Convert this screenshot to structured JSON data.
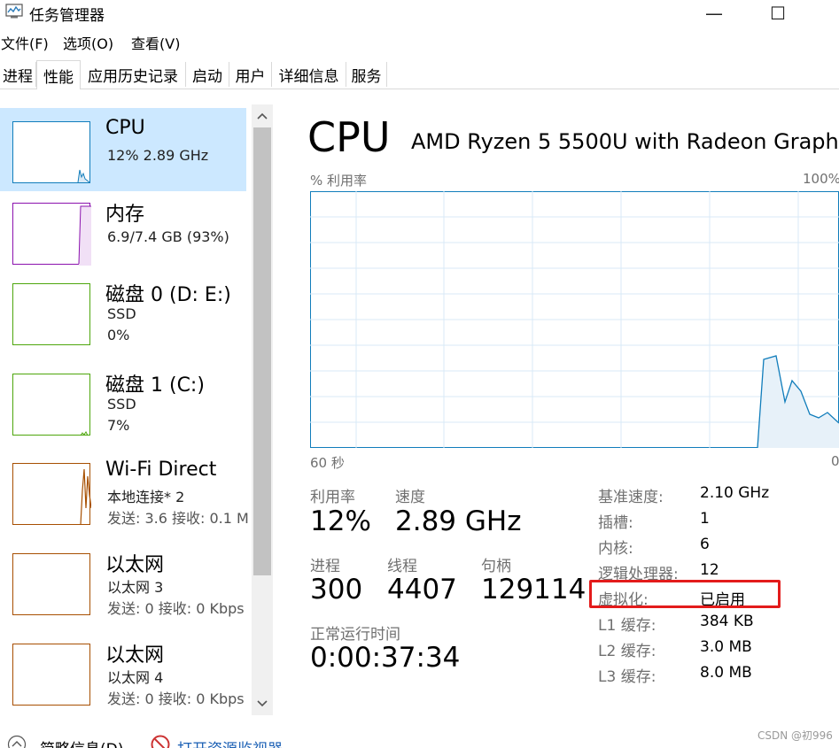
{
  "window": {
    "title": "任务管理器",
    "minimize_glyph": "—",
    "maximize_glyph": "☐"
  },
  "menu": [
    "文件(F)",
    "选项(O)",
    "查看(V)"
  ],
  "tabs": [
    "进程",
    "性能",
    "应用历史记录",
    "启动",
    "用户",
    "详细信息",
    "服务"
  ],
  "active_tab": "性能",
  "resources": [
    {
      "name": "CPU",
      "lines": [
        "12%  2.89 GHz"
      ],
      "color": "#117dbb"
    },
    {
      "name": "内存",
      "lines": [
        "6.9/7.4 GB (93%)"
      ],
      "color": "#8b12ae"
    },
    {
      "name": "磁盘 0 (D: E:)",
      "lines": [
        "SSD",
        "0%"
      ],
      "color": "#4da60c"
    },
    {
      "name": "磁盘 1 (C:)",
      "lines": [
        "SSD",
        "7%"
      ],
      "color": "#4da60c"
    },
    {
      "name": "Wi-Fi Direct",
      "lines": [
        "本地连接* 2",
        "发送: 3.6  接收: 0.1 M"
      ],
      "color": "#a74f01"
    },
    {
      "name": "以太网",
      "lines": [
        "以太网 3",
        "发送: 0  接收: 0 Kbps"
      ],
      "color": "#a74f01"
    },
    {
      "name": "以太网",
      "lines": [
        "以太网 4",
        "发送: 0  接收: 0 Kbps"
      ],
      "color": "#a74f01"
    }
  ],
  "cpu": {
    "heading": "CPU",
    "model": "AMD Ryzen 5 5500U with Radeon Graph...",
    "util_label": "% 利用率",
    "util_max": "100%",
    "x_left": "60 秒",
    "x_right": "0",
    "graph_color": "#117dbb",
    "stats": {
      "utilization_label": "利用率",
      "utilization": "12%",
      "speed_label": "速度",
      "speed": "2.89 GHz",
      "processes_label": "进程",
      "processes": "300",
      "threads_label": "线程",
      "threads": "4407",
      "handles_label": "句柄",
      "handles": "129114",
      "uptime_label": "正常运行时间",
      "uptime": "0:00:37:34"
    },
    "specs": [
      {
        "label": "基准速度:",
        "value": "2.10 GHz"
      },
      {
        "label": "插槽:",
        "value": "1"
      },
      {
        "label": "内核:",
        "value": "6"
      },
      {
        "label": "逻辑处理器:",
        "value": "12"
      },
      {
        "label": "虚拟化:",
        "value": "已启用"
      },
      {
        "label": "L1 缓存:",
        "value": "384 KB"
      },
      {
        "label": "L2 缓存:",
        "value": "3.0 MB"
      },
      {
        "label": "L3 缓存:",
        "value": "8.0 MB"
      }
    ],
    "highlight_color": "#e31b1b"
  },
  "bottom": {
    "summary": "简略信息(D)",
    "open_monitor": "打开资源监视器"
  },
  "watermark": "CSDN @初996"
}
